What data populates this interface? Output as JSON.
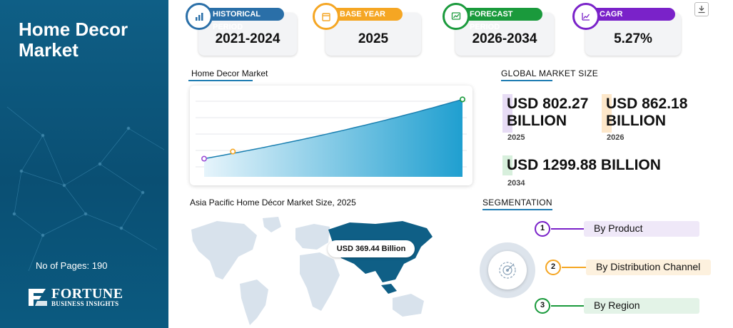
{
  "sidebar": {
    "title_line1": "Home Decor",
    "title_line2": "Market",
    "pages": "No of Pages: 190",
    "logo_main": "FORTUNE",
    "logo_sub": "BUSINESS INSIGHTS"
  },
  "cards": [
    {
      "label": "HISTORICAL PERIOD",
      "value": "2021-2024",
      "color": "#2a6fa8",
      "icon": "bar-chart-icon"
    },
    {
      "label": "BASE YEAR",
      "value": "2025",
      "color": "#f5a623",
      "icon": "calendar-icon"
    },
    {
      "label": "FORECAST PERIOD",
      "value": "2026-2034",
      "color": "#1a9a3c",
      "icon": "forecast-chart-icon"
    },
    {
      "label": "CAGR",
      "value": "5.27%",
      "color": "#7a22c9",
      "icon": "growth-chart-icon"
    }
  ],
  "chart": {
    "label": "Home Decor Market"
  },
  "chart_data": {
    "type": "area",
    "title": "Home Decor Market",
    "xlabel": "",
    "ylabel": "",
    "x": [
      2025,
      2026,
      2034
    ],
    "series": [
      {
        "values": [
          802.27,
          862.18,
          1299.88
        ]
      }
    ],
    "highlight_colors": [
      "#9b4dd6",
      "#f5a623",
      "#1a9a3c"
    ],
    "accent": "#1f9fd0",
    "grid": true
  },
  "global": {
    "label": "GLOBAL MARKET SIZE",
    "items": [
      {
        "line1": "USD 802.27",
        "line2": "BILLION",
        "year": "2025",
        "color": "#e7dcf5"
      },
      {
        "line1": "USD 862.18",
        "line2": "BILLION",
        "year": "2026",
        "color": "#fde7c9"
      },
      {
        "line1": "USD 1299.88 BILLION",
        "year": "2034",
        "color": "#d7efdc"
      }
    ]
  },
  "map": {
    "label": "Asia Pacific Home Décor Market Size, 2025",
    "value": "USD 369.44 Billion",
    "highlight_color": "#0f5f86",
    "base_color": "#d8e2ec"
  },
  "segmentation": {
    "label": "SEGMENTATION",
    "items": [
      {
        "num": "1",
        "text": "By Product",
        "color": "#7a22c9",
        "bar": "#efe8f8"
      },
      {
        "num": "2",
        "text": "By Distribution Channel",
        "color": "#f5a623",
        "bar": "#fdf1de"
      },
      {
        "num": "3",
        "text": "By Region",
        "color": "#1a9a3c",
        "bar": "#e3f3e7"
      }
    ]
  }
}
